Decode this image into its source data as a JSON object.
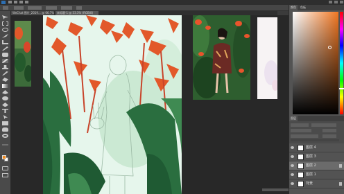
{
  "tabs": [
    {
      "label": "WeChat 图片_2019... @ 66.7%"
    },
    {
      "label": "未标题-1 @ 33.3% (RGB/8)"
    }
  ],
  "panels": {
    "tabs": [
      {
        "label": "颜色"
      },
      {
        "label": "色板"
      }
    ]
  },
  "colors": {
    "accent": "#f08a1f",
    "background_color": "#ffffff",
    "leaf_orange": "#e2582a",
    "leaf_dark": "#2a6e3f",
    "canvas_bg": "#e6f6ec"
  },
  "layers": {
    "header": "图层",
    "items": [
      {
        "name": "图层 4",
        "selected": false
      },
      {
        "name": "图层 3",
        "selected": false
      },
      {
        "name": "图层 2",
        "selected": true
      },
      {
        "name": "图层 1",
        "selected": false
      },
      {
        "name": "背景",
        "selected": false
      }
    ]
  }
}
